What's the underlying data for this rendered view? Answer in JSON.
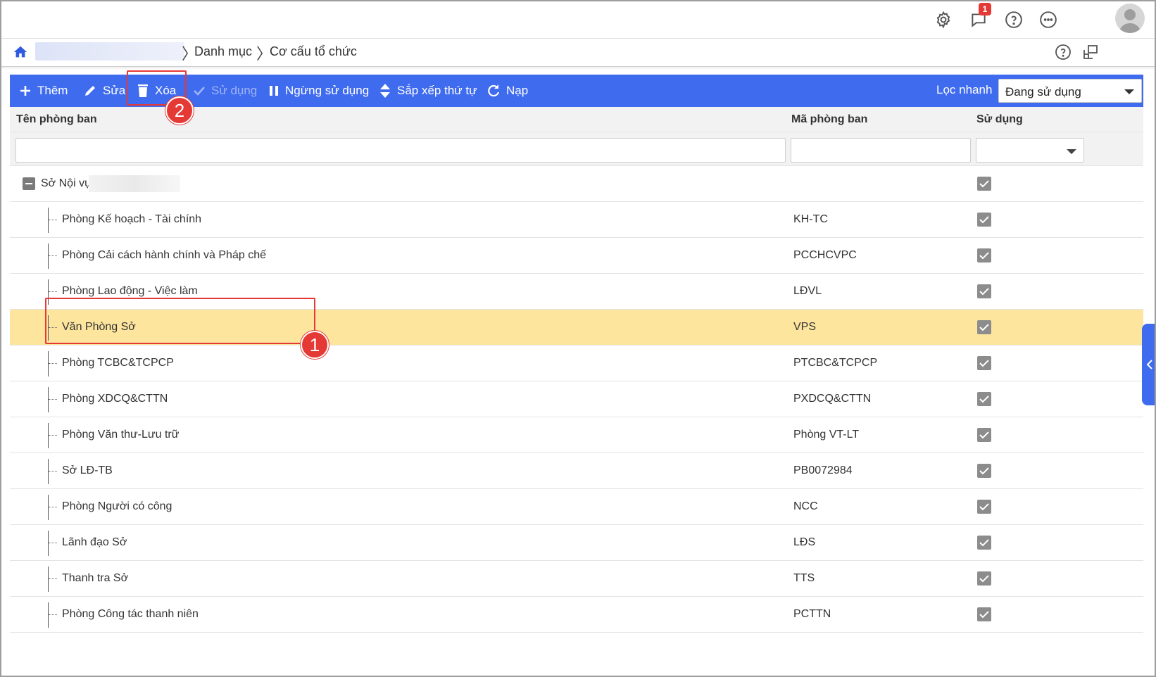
{
  "topbar": {
    "notification_count": "1",
    "icons": [
      "gear-icon",
      "chat-icon",
      "help-icon",
      "more-icon",
      "user-avatar"
    ]
  },
  "breadcrumb": {
    "items": [
      "Danh mục",
      "Cơ cấu tổ chức"
    ]
  },
  "toolbar": {
    "add": "Thêm",
    "edit": "Sửa",
    "delete": "Xóa",
    "use": "Sử dụng",
    "stop_use": "Ngừng sử dụng",
    "sort": "Sắp xếp thứ tự",
    "reload": "Nạp",
    "quick_filter_label": "Lọc nhanh",
    "quick_filter_value": "Đang sử dụng"
  },
  "table": {
    "headers": {
      "name": "Tên phòng ban",
      "code": "Mã phòng ban",
      "in_use": "Sử dụng"
    },
    "root": {
      "name": "Sở Nội vụ",
      "in_use": true
    },
    "rows": [
      {
        "name": "Phòng Kế hoạch - Tài chính",
        "code": "KH-TC",
        "in_use": true
      },
      {
        "name": "Phòng Cải cách hành chính và Pháp chế",
        "code": "PCCHCVPC",
        "in_use": true
      },
      {
        "name": "Phòng Lao động - Việc làm",
        "code": "LĐVL",
        "in_use": true
      },
      {
        "name": "Văn Phòng Sở",
        "code": "VPS",
        "in_use": true,
        "selected": true
      },
      {
        "name": "Phòng TCBC&TCPCP",
        "code": "PTCBC&TCPCP",
        "in_use": true
      },
      {
        "name": "Phòng XDCQ&CTTN",
        "code": "PXDCQ&CTTN",
        "in_use": true
      },
      {
        "name": "Phòng Văn thư-Lưu trữ",
        "code": "Phòng VT-LT",
        "in_use": true
      },
      {
        "name": "Sở LĐ-TB",
        "code": "PB0072984",
        "in_use": true
      },
      {
        "name": "Phòng Người có công",
        "code": "NCC",
        "in_use": true
      },
      {
        "name": "Lãnh đạo Sở",
        "code": "LĐS",
        "in_use": true
      },
      {
        "name": "Thanh tra Sở",
        "code": "TTS",
        "in_use": true
      },
      {
        "name": "Phòng Công tác thanh niên",
        "code": "PCTTN",
        "in_use": true
      }
    ]
  },
  "annotations": {
    "callout_1": "1",
    "callout_2": "2"
  },
  "colors": {
    "toolbar_bg": "#3f6bef",
    "selected_row": "#fde59e",
    "annotation": "#e53935"
  }
}
